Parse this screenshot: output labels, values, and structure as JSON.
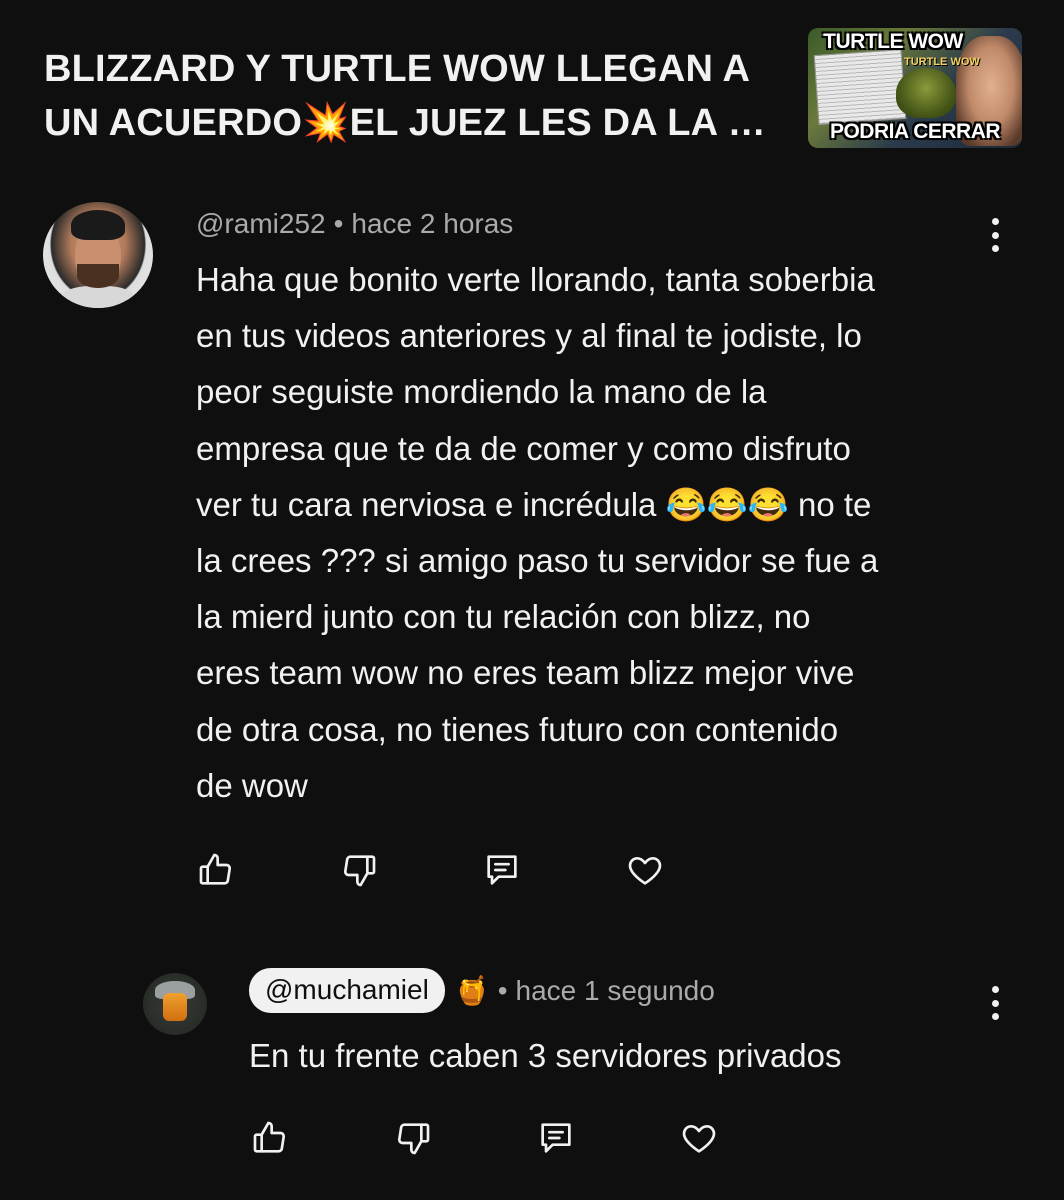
{
  "video": {
    "title_line1": "BLIZZARD Y TURTLE WOW LLEGAN A",
    "title_line2": "UN ACUERDO💥EL JUEZ LES DA LA …",
    "thumbnail": {
      "top_text": "TURTLE WOW",
      "logo_text": "TURTLE WOW",
      "bottom_text": "PODRIA CERRAR"
    }
  },
  "comment": {
    "handle": "@rami252",
    "separator": "•",
    "time": "hace 2 horas",
    "lines": [
      "Haha que bonito verte llorando, tanta soberbia",
      "en tus videos anteriores y al final te jodiste, lo",
      "peor seguiste mordiendo la mano de la",
      "empresa que te da de comer y como disfruto",
      "ver tu cara nerviosa e incrédula 😂😂😂 no te",
      "la crees ??? si amigo paso tu servidor se fue a",
      "la mierd junto con tu relación con blizz, no",
      "eres team wow no eres team blizz mejor vive",
      "de otra cosa, no tienes futuro con contenido",
      "de wow"
    ]
  },
  "reply": {
    "handle": "@muchamiel",
    "badge_emoji": "🍯",
    "separator": "•",
    "time": "hace 1 segundo",
    "text": "En tu frente caben 3 servidores privados"
  },
  "icons": {
    "like": "thumbs-up-icon",
    "dislike": "thumbs-down-icon",
    "reply": "comment-icon",
    "heart": "heart-icon",
    "more": "more-vert-icon"
  },
  "colors": {
    "background": "#0f0f0f",
    "text": "#f1f1f1",
    "secondary_text": "#aaaaaa"
  }
}
